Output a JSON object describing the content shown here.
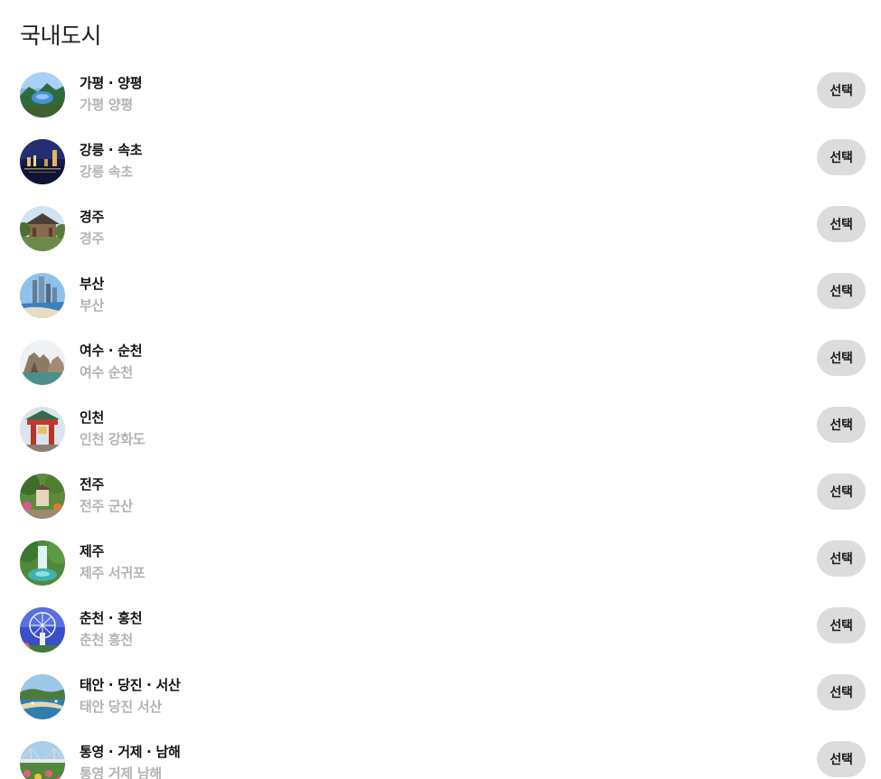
{
  "section": {
    "title": "국내도시"
  },
  "cities": [
    {
      "name": "가평 · 양평",
      "sub": "가평 양평",
      "button": "선택",
      "thumb": "mountain-lake-photo"
    },
    {
      "name": "강릉 · 속초",
      "sub": "강릉 속초",
      "button": "선택",
      "thumb": "night-harbor-photo"
    },
    {
      "name": "경주",
      "sub": "경주",
      "button": "선택",
      "thumb": "temple-photo"
    },
    {
      "name": "부산",
      "sub": "부산",
      "button": "선택",
      "thumb": "beach-city-photo"
    },
    {
      "name": "여수 · 순천",
      "sub": "여수 순천",
      "button": "선택",
      "thumb": "sea-cliff-photo"
    },
    {
      "name": "인천",
      "sub": "인천 강화도",
      "button": "선택",
      "thumb": "chinatown-gate-photo"
    },
    {
      "name": "전주",
      "sub": "전주 군산",
      "button": "선택",
      "thumb": "garden-photo"
    },
    {
      "name": "제주",
      "sub": "제주 서귀포",
      "button": "선택",
      "thumb": "waterfall-photo"
    },
    {
      "name": "춘천 · 홍천",
      "sub": "춘천 홍천",
      "button": "선택",
      "thumb": "ferris-wheel-photo"
    },
    {
      "name": "태안 · 당진 · 서산",
      "sub": "태안 당진 서산",
      "button": "선택",
      "thumb": "coast-photo"
    },
    {
      "name": "통영 · 거제 · 남해",
      "sub": "통영 거제 남해",
      "button": "선택",
      "thumb": "bridge-flowers-photo"
    }
  ]
}
